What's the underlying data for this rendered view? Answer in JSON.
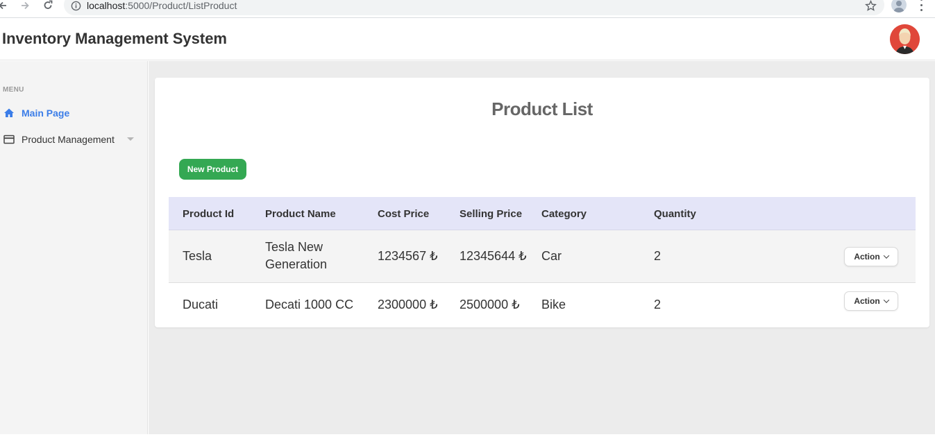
{
  "browser": {
    "url_host": "localhost",
    "url_rest": ":5000/Product/ListProduct"
  },
  "header": {
    "title": "Inventory Management System"
  },
  "sidebar": {
    "menu_heading": "MENU",
    "items": [
      {
        "label": "Main Page",
        "icon": "home-icon",
        "active": true
      },
      {
        "label": "Product Management",
        "icon": "card-icon",
        "active": false
      }
    ]
  },
  "main": {
    "title": "Product List",
    "new_button": "New Product",
    "columns": [
      "Product Id",
      "Product Name",
      "Cost Price",
      "Selling Price",
      "Category",
      "Quantity"
    ],
    "rows": [
      {
        "id": "Tesla",
        "name_line1": "Tesla New",
        "name_line2": "Generation",
        "cost": "1234567 ₺",
        "selling": "12345644 ₺",
        "category": "Car",
        "quantity": "2",
        "action": "Action"
      },
      {
        "id": "Ducati",
        "name_line1": "Decati 1000 CC",
        "name_line2": "",
        "cost": "2300000 ₺",
        "selling": "2500000 ₺",
        "category": "Bike",
        "quantity": "2",
        "action": "Action"
      }
    ]
  },
  "colors": {
    "accent": "#3b7de8",
    "new_button": "#34a853",
    "table_header": "#e4e5f8",
    "avatar": "#e0473a"
  }
}
